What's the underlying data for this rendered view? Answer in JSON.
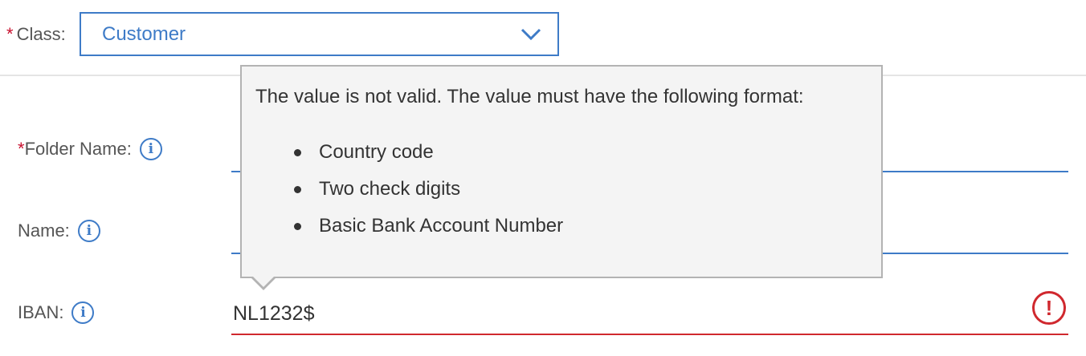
{
  "class_field": {
    "required_mark": "*",
    "label": "Class:",
    "selected_value": "Customer"
  },
  "folder_name": {
    "required_mark": "*",
    "label": "Folder Name:",
    "value": ""
  },
  "name_field": {
    "label": "Name:",
    "value": ""
  },
  "iban": {
    "label": "IBAN:",
    "value": "NL1232$"
  },
  "tooltip": {
    "message": "The value is not valid. The value must have the following format:",
    "items": [
      "Country code",
      "Two check digits",
      "Basic Bank Account Number"
    ]
  },
  "icons": {
    "info": "info-icon",
    "error": "error-icon",
    "dropdown": "chevron-down-icon"
  },
  "colors": {
    "accent": "#3e7bc7",
    "error": "#d0282e",
    "required": "#c8102e",
    "tooltip_bg": "#f4f4f4"
  }
}
